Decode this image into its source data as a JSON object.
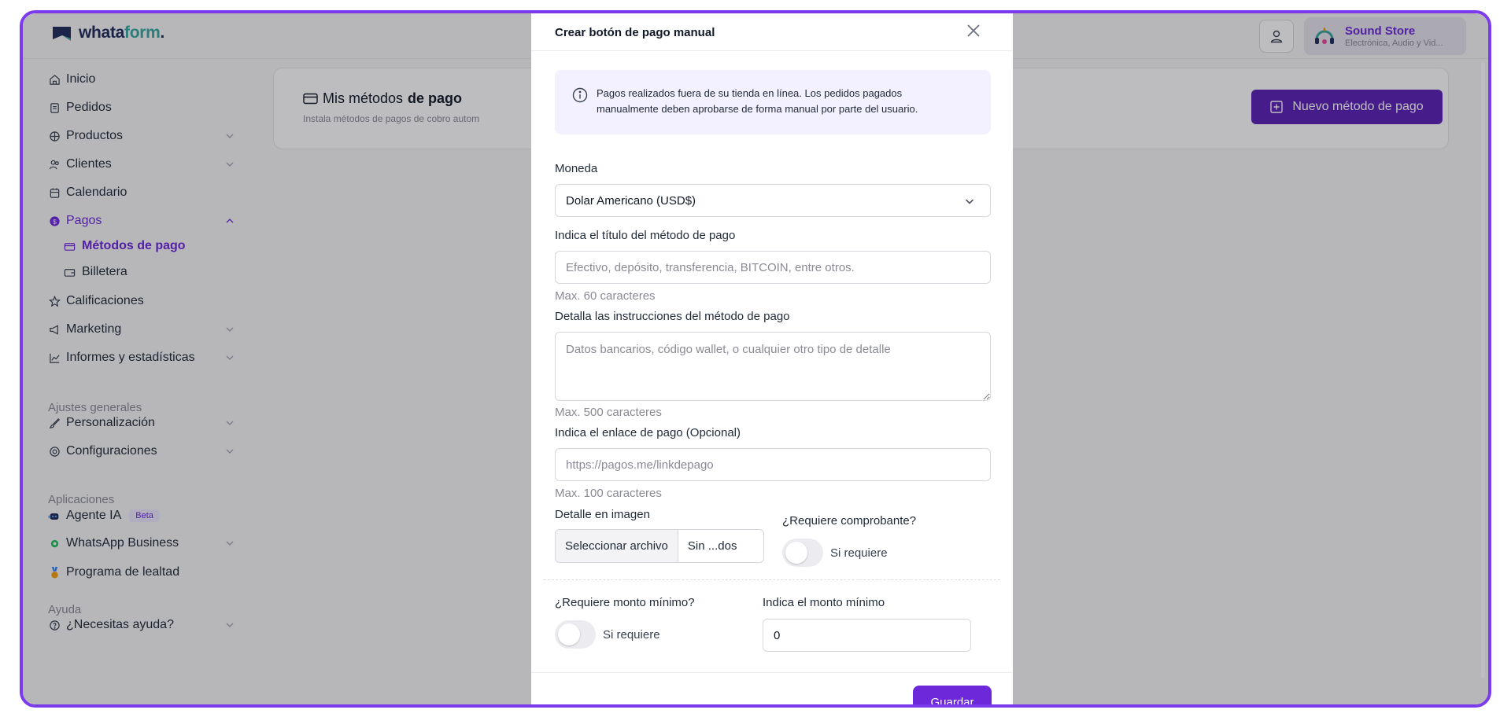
{
  "app": {
    "logo_prefix": "whata",
    "logo_accent": "form",
    "logo_suffix": "."
  },
  "header": {
    "store_name": "Sound Store",
    "store_subtitle": "Electrónica, Audio y Vid..."
  },
  "sidebar": {
    "items": [
      {
        "label": "Inicio"
      },
      {
        "label": "Pedidos"
      },
      {
        "label": "Productos"
      },
      {
        "label": "Clientes"
      },
      {
        "label": "Calendario"
      },
      {
        "label": "Pagos"
      },
      {
        "label": "Métodos de pago"
      },
      {
        "label": "Billetera"
      },
      {
        "label": "Calificaciones"
      },
      {
        "label": "Marketing"
      },
      {
        "label": "Informes y estadísticas"
      },
      {
        "label": "Personalización"
      },
      {
        "label": "Configuraciones"
      },
      {
        "label": "Agente IA"
      },
      {
        "label": "WhatsApp Business"
      },
      {
        "label": "Programa de lealtad"
      },
      {
        "label": "¿Necesitas ayuda?"
      }
    ],
    "sections": {
      "general": "Ajustes generales",
      "apps": "Aplicaciones",
      "help": "Ayuda"
    },
    "beta_badge": "Beta"
  },
  "main": {
    "title_prefix": "Mis métodos",
    "title_bold": "de pago",
    "subtitle": "Instala métodos de pagos de cobro autom",
    "new_button": "Nuevo método de pago"
  },
  "modal": {
    "title": "Crear botón de pago manual",
    "info": "Pagos realizados fuera de su tienda en línea. Los pedidos pagados manualmente deben aprobarse de forma manual por parte del usuario.",
    "currency_label": "Moneda",
    "currency_value": "Dolar Americano (USD$)",
    "title_label": "Indica el título del método de pago",
    "title_placeholder": "Efectivo, depósito, transferencia, BITCOIN, entre otros.",
    "title_hint": "Max. 60 caracteres",
    "instructions_label": "Detalla las instrucciones del método de pago",
    "instructions_placeholder": "Datos bancarios, código wallet, o cualquier otro tipo de detalle",
    "instructions_hint": "Max. 500 caracteres",
    "link_label": "Indica el enlace de pago (Opcional)",
    "link_placeholder": "https://pagos.me/linkdepago",
    "link_hint": "Max. 100 caracteres",
    "image_label": "Detalle en imagen",
    "file_button": "Seleccionar archivo",
    "file_name": "Sin ...dos",
    "receipt_label": "¿Requiere comprobante?",
    "receipt_toggle": "Si requiere",
    "min_label": "¿Requiere monto mínimo?",
    "min_toggle": "Si requiere",
    "min_amount_label": "Indica el monto mínimo",
    "min_amount_value": "0",
    "save_button": "Guardar"
  },
  "colors": {
    "accent": "#6d28d9",
    "frame": "#7c3aed",
    "info_bg": "#f3f0ff"
  }
}
